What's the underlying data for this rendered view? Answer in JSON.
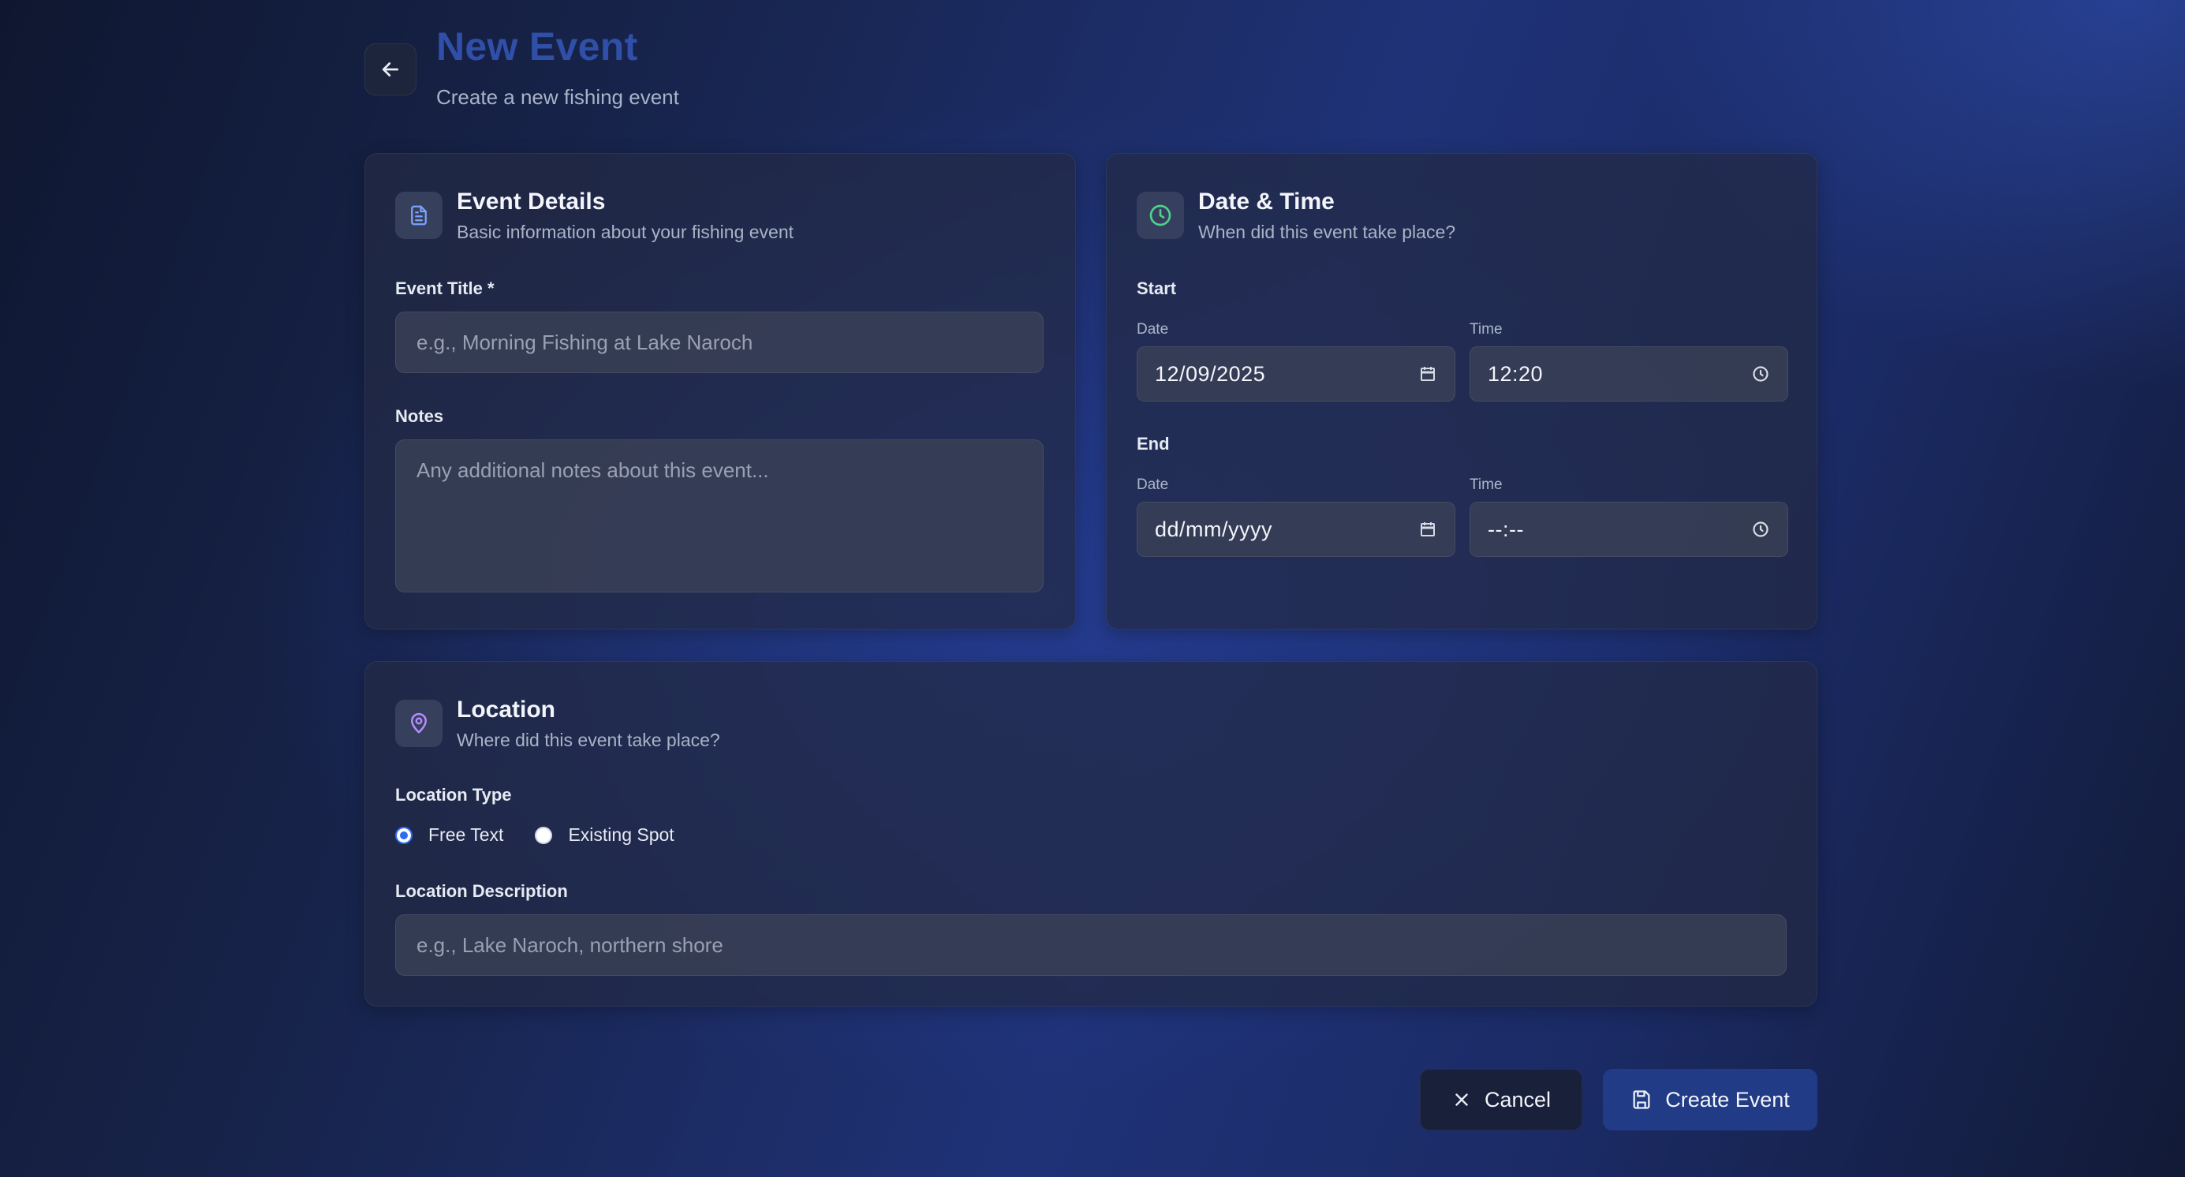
{
  "header": {
    "title": "New Event",
    "subtitle": "Create a new fishing event"
  },
  "event_details": {
    "title": "Event Details",
    "subtitle": "Basic information about your fishing event",
    "title_label": "Event Title *",
    "title_placeholder": "e.g., Morning Fishing at Lake Naroch",
    "notes_label": "Notes",
    "notes_placeholder": "Any additional notes about this event..."
  },
  "date_time": {
    "title": "Date & Time",
    "subtitle": "When did this event take place?",
    "start_label": "Start",
    "end_label": "End",
    "date_label": "Date",
    "time_label": "Time",
    "start_date": "12/09/2025",
    "start_time": "12:20",
    "end_date": "dd/mm/yyyy",
    "end_time": "--:--"
  },
  "location": {
    "title": "Location",
    "subtitle": "Where did this event take place?",
    "type_label": "Location Type",
    "options": [
      "Free Text",
      "Existing Spot"
    ],
    "selected": "Free Text",
    "description_label": "Location Description",
    "description_placeholder": "e.g., Lake Naroch, northern shore"
  },
  "actions": {
    "cancel": "Cancel",
    "create": "Create Event"
  },
  "icons": {
    "back": "arrow-left-icon",
    "details": "document-icon",
    "datetime": "clock-icon",
    "location": "map-pin-icon",
    "calendar": "calendar-icon",
    "time": "clock-icon",
    "cancel": "close-icon",
    "create": "save-icon"
  },
  "colors": {
    "title_accent": "#2f4fa8",
    "primary_button": "#213b86",
    "details_icon": "#7da2ff",
    "datetime_icon": "#4ed18a",
    "location_icon": "#b48cff",
    "radio_selected": "#2e6cf0"
  }
}
